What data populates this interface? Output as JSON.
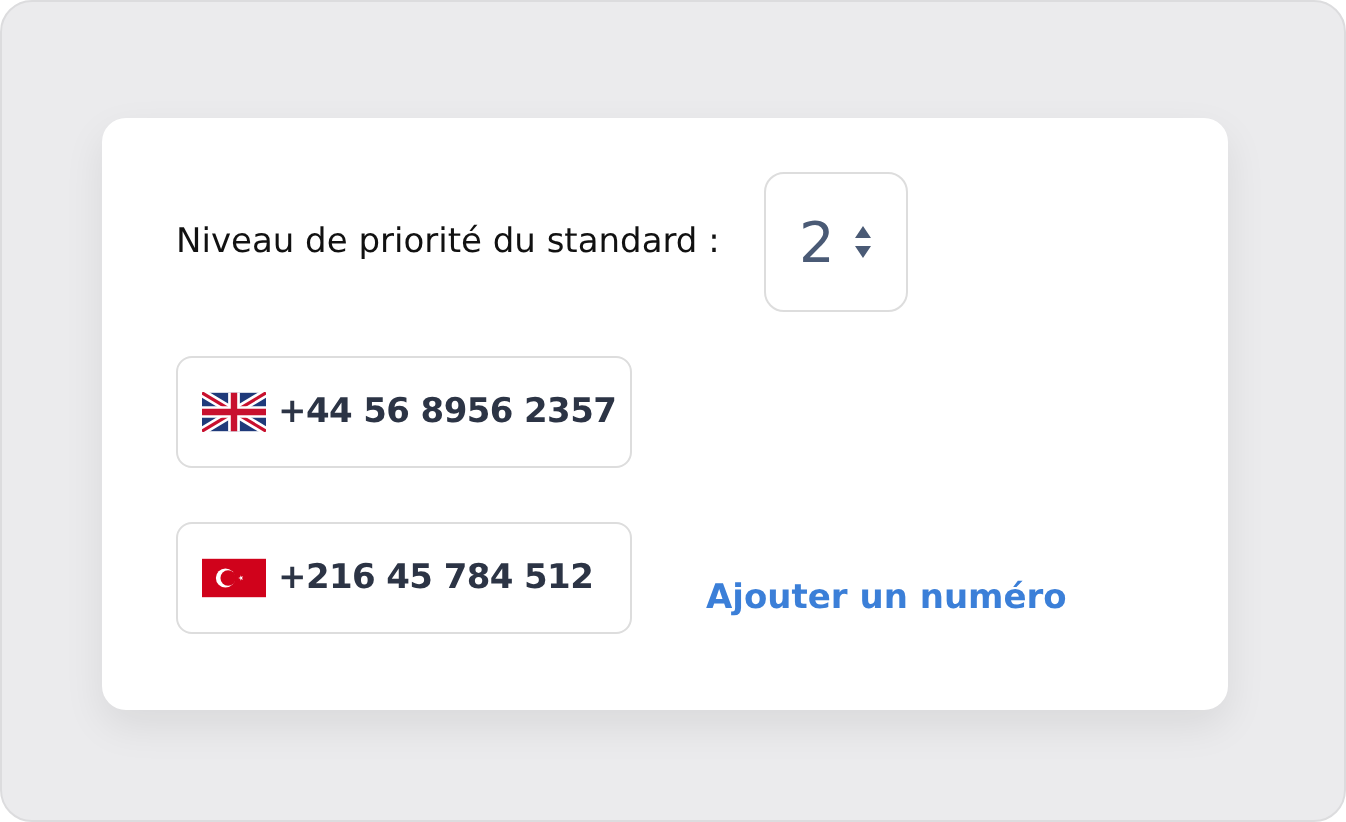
{
  "priority": {
    "label": "Niveau de priorité du standard :",
    "value": "2"
  },
  "phones": [
    {
      "kind": "uk",
      "number": "+44 56 8956 2357"
    },
    {
      "kind": "tr",
      "number": "+216 45 784 512"
    }
  ],
  "add_link": "Ajouter un numéro"
}
